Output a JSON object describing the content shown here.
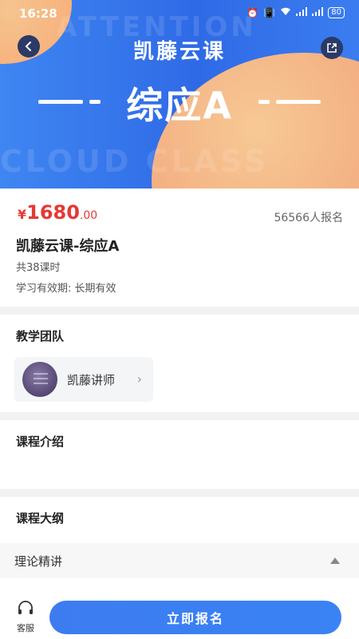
{
  "status": {
    "time": "16:28",
    "battery": "80"
  },
  "banner": {
    "brand": "凯藤云课",
    "title": "综应A",
    "ghost_top": "ATTENTION",
    "ghost_bottom": "CLOUD CLASS"
  },
  "course": {
    "price_symbol": "¥",
    "price_int": "1680",
    "price_dec": ".00",
    "enrolled": "56566人报名",
    "title": "凯藤云课-综应A",
    "lessons": "共38课时",
    "validity": "学习有效期: 长期有效"
  },
  "team": {
    "title": "教学团队",
    "teacher_name": "凯藤讲师"
  },
  "intro": {
    "title": "课程介绍"
  },
  "outline": {
    "title": "课程大纲",
    "item": "理论精讲"
  },
  "bottom": {
    "service_label": "客服",
    "enroll_label": "立即报名"
  },
  "colors": {
    "accent": "#3a7ef2",
    "price": "#e53935"
  }
}
